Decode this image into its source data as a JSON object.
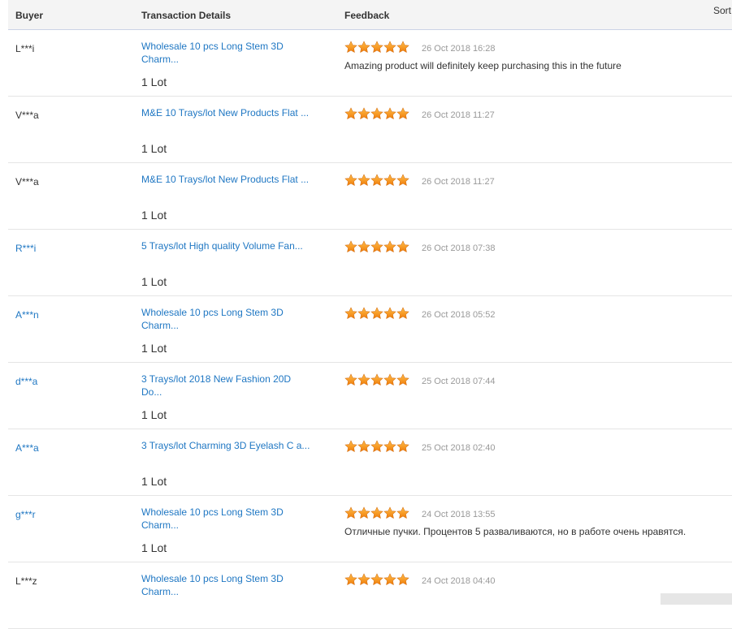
{
  "header": {
    "buyer": "Buyer",
    "details": "Transaction Details",
    "feedback": "Feedback",
    "sort": "Sort"
  },
  "rows": [
    {
      "buyer": "L***i",
      "buyer_link": false,
      "product": "Wholesale 10 pcs Long Stem 3D Charm...",
      "qty": "1 Lot",
      "rating": 5,
      "date": "26 Oct 2018 16:28",
      "comment": "Amazing product will definitely keep purchasing this in the future"
    },
    {
      "buyer": "V***a",
      "buyer_link": false,
      "product": "M&E 10 Trays/lot New Products Flat ...",
      "qty": "1 Lot",
      "rating": 5,
      "date": "26 Oct 2018 11:27",
      "comment": ""
    },
    {
      "buyer": "V***a",
      "buyer_link": false,
      "product": "M&E 10 Trays/lot New Products Flat ...",
      "qty": "1 Lot",
      "rating": 5,
      "date": "26 Oct 2018 11:27",
      "comment": ""
    },
    {
      "buyer": "R***i",
      "buyer_link": true,
      "product": "5 Trays/lot High quality Volume Fan...",
      "qty": "1 Lot",
      "rating": 5,
      "date": "26 Oct 2018 07:38",
      "comment": ""
    },
    {
      "buyer": "A***n",
      "buyer_link": true,
      "product": "Wholesale 10 pcs Long Stem 3D Charm...",
      "qty": "1 Lot",
      "rating": 5,
      "date": "26 Oct 2018 05:52",
      "comment": ""
    },
    {
      "buyer": "d***a",
      "buyer_link": true,
      "product": "3 Trays/lot 2018 New Fashion 20D Do...",
      "qty": "1 Lot",
      "rating": 5,
      "date": "25 Oct 2018 07:44",
      "comment": ""
    },
    {
      "buyer": "A***a",
      "buyer_link": true,
      "product": "3 Trays/lot Charming 3D Eyelash C a...",
      "qty": "1 Lot",
      "rating": 5,
      "date": "25 Oct 2018 02:40",
      "comment": ""
    },
    {
      "buyer": "g***r",
      "buyer_link": true,
      "product": "Wholesale 10 pcs Long Stem 3D Charm...",
      "qty": "1 Lot",
      "rating": 5,
      "date": "24 Oct 2018 13:55",
      "comment": "Отличные пучки. Процентов 5 разваливаются, но в работе очень нравятся."
    },
    {
      "buyer": "L***z",
      "buyer_link": false,
      "product": "Wholesale 10 pcs Long Stem 3D Charm...",
      "qty": "",
      "rating": 5,
      "date": "24 Oct 2018 04:40",
      "comment": ""
    }
  ],
  "colors": {
    "link": "#1f77c3",
    "star": "#f7931e",
    "date": "#999999"
  },
  "icons": {
    "rating": "star-icon"
  }
}
